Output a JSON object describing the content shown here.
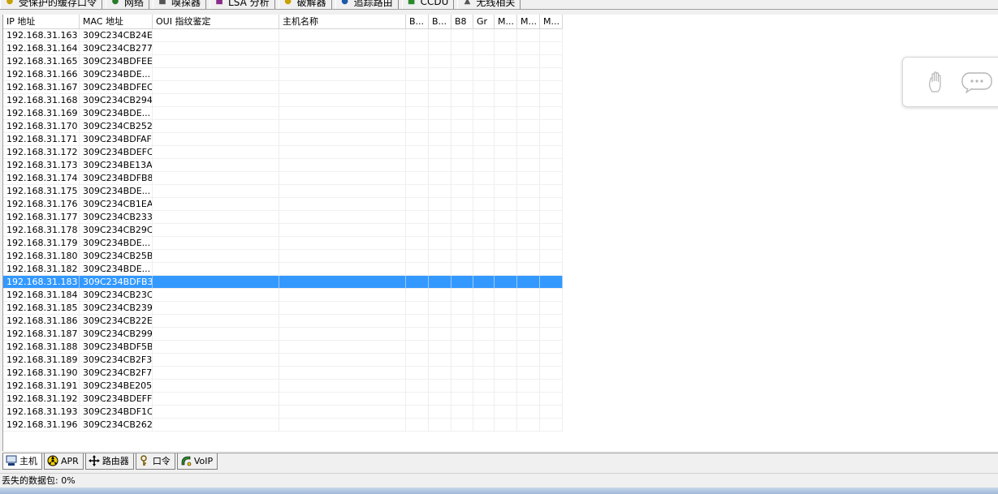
{
  "top_tabs": [
    {
      "label": "受保护的缓存口令",
      "icon": "protected-cache-icon",
      "color": "#c8a000"
    },
    {
      "label": "网络",
      "icon": "network-icon",
      "color": "#2a7a2a"
    },
    {
      "label": "嗅探器",
      "icon": "sniffer-icon",
      "color": "#555555"
    },
    {
      "label": "LSA 分析",
      "icon": "lsa-icon",
      "color": "#8a2a8a"
    },
    {
      "label": "破解器",
      "icon": "cracker-icon",
      "color": "#c8a000"
    },
    {
      "label": "追踪路由",
      "icon": "traceroute-icon",
      "color": "#1a5aa8"
    },
    {
      "label": "CCDU",
      "icon": "ccdu-icon",
      "color": "#2a8a2a"
    },
    {
      "label": "无线相关",
      "icon": "wireless-icon",
      "color": "#555555"
    }
  ],
  "grid": {
    "columns": [
      {
        "key": "ip",
        "label": "IP 地址"
      },
      {
        "key": "mac",
        "label": "MAC 地址"
      },
      {
        "key": "oui",
        "label": "OUI 指纹鉴定"
      },
      {
        "key": "host",
        "label": "主机名称"
      },
      {
        "key": "b1",
        "label": "B..."
      },
      {
        "key": "b2",
        "label": "B..."
      },
      {
        "key": "b8",
        "label": "B8"
      },
      {
        "key": "gr",
        "label": "Gr"
      },
      {
        "key": "m1",
        "label": "M..."
      },
      {
        "key": "m2",
        "label": "M..."
      },
      {
        "key": "m3",
        "label": "M..."
      }
    ],
    "selected_row": 19,
    "selection_color": "#3399ff",
    "rows": [
      {
        "ip": "192.168.31.163",
        "mac": "309C234CB24E"
      },
      {
        "ip": "192.168.31.164",
        "mac": "309C234CB277"
      },
      {
        "ip": "192.168.31.165",
        "mac": "309C234BDFEE"
      },
      {
        "ip": "192.168.31.166",
        "mac": "309C234BDE..."
      },
      {
        "ip": "192.168.31.167",
        "mac": "309C234BDFEC"
      },
      {
        "ip": "192.168.31.168",
        "mac": "309C234CB294"
      },
      {
        "ip": "192.168.31.169",
        "mac": "309C234BDE..."
      },
      {
        "ip": "192.168.31.170",
        "mac": "309C234CB252"
      },
      {
        "ip": "192.168.31.171",
        "mac": "309C234BDFAF"
      },
      {
        "ip": "192.168.31.172",
        "mac": "309C234BDEFC"
      },
      {
        "ip": "192.168.31.173",
        "mac": "309C234BE13A"
      },
      {
        "ip": "192.168.31.174",
        "mac": "309C234BDFB8"
      },
      {
        "ip": "192.168.31.175",
        "mac": "309C234BDE..."
      },
      {
        "ip": "192.168.31.176",
        "mac": "309C234CB1EA"
      },
      {
        "ip": "192.168.31.177",
        "mac": "309C234CB233"
      },
      {
        "ip": "192.168.31.178",
        "mac": "309C234CB29C"
      },
      {
        "ip": "192.168.31.179",
        "mac": "309C234BDE..."
      },
      {
        "ip": "192.168.31.180",
        "mac": "309C234CB25B"
      },
      {
        "ip": "192.168.31.182",
        "mac": "309C234BDE..."
      },
      {
        "ip": "192.168.31.183",
        "mac": "309C234BDFB3"
      },
      {
        "ip": "192.168.31.184",
        "mac": "309C234CB23C"
      },
      {
        "ip": "192.168.31.185",
        "mac": "309C234CB239"
      },
      {
        "ip": "192.168.31.186",
        "mac": "309C234CB22E"
      },
      {
        "ip": "192.168.31.187",
        "mac": "309C234CB299"
      },
      {
        "ip": "192.168.31.188",
        "mac": "309C234BDF5B"
      },
      {
        "ip": "192.168.31.189",
        "mac": "309C234CB2F3"
      },
      {
        "ip": "192.168.31.190",
        "mac": "309C234CB2F7"
      },
      {
        "ip": "192.168.31.191",
        "mac": "309C234BE205"
      },
      {
        "ip": "192.168.31.192",
        "mac": "309C234BDEFF"
      },
      {
        "ip": "192.168.31.193",
        "mac": "309C234BDF1C"
      },
      {
        "ip": "192.168.31.196",
        "mac": "309C234CB262"
      }
    ]
  },
  "bottom_tabs": [
    {
      "label": "主机",
      "icon": "host-icon"
    },
    {
      "label": "APR",
      "icon": "apr-icon"
    },
    {
      "label": "路由器",
      "icon": "router-icon"
    },
    {
      "label": "口令",
      "icon": "password-icon"
    },
    {
      "label": "VoIP",
      "icon": "voip-icon"
    }
  ],
  "status": {
    "lost_packets_label": "丢失的数据包:",
    "lost_packets_value": "0%"
  },
  "float_widget": {
    "icons": [
      "hand-icon",
      "chat-bubble-icon"
    ]
  }
}
